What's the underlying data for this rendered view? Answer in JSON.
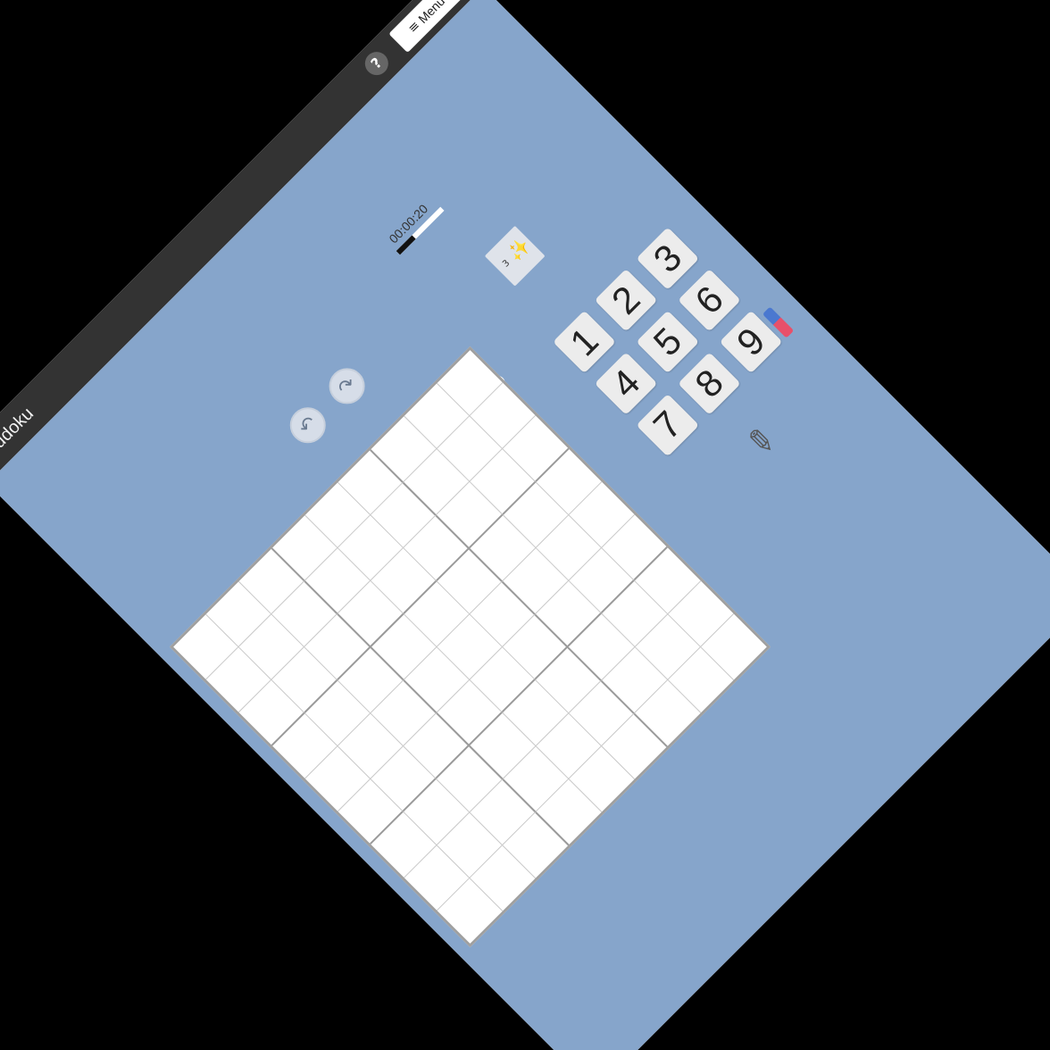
{
  "header": {
    "title": "Sudoku",
    "help_label": "?",
    "menu_label": "Menu",
    "menu_icon": "≡"
  },
  "toolbar": {
    "undo_icon": "undo-icon",
    "redo_icon": "redo-icon",
    "timer": "00:00:20",
    "timer_progress": 0.35,
    "hint_number": "3",
    "notes_numbers": [
      "1",
      "2",
      "3"
    ]
  },
  "keypad": {
    "keys": [
      "1",
      "2",
      "3",
      "4",
      "5",
      "6",
      "7",
      "8",
      "9"
    ]
  },
  "board": {
    "rows": [
      [
        "",
        "",
        "",
        "",
        "",
        "",
        "",
        "",
        ""
      ],
      [
        "",
        "",
        "",
        "",
        "",
        "",
        "",
        "",
        ""
      ],
      [
        "",
        "",
        "",
        "",
        "",
        "",
        "",
        "",
        ""
      ],
      [
        "",
        "",
        "",
        "",
        "",
        "",
        "",
        "",
        ""
      ],
      [
        "",
        "",
        "",
        "",
        "",
        "",
        "",
        "",
        ""
      ],
      [
        "",
        "",
        "",
        "",
        "",
        "",
        "",
        "",
        ""
      ],
      [
        "",
        "",
        "",
        "",
        "",
        "",
        "",
        "",
        ""
      ],
      [
        "",
        "",
        "",
        "",
        "",
        "",
        "",
        "",
        ""
      ],
      [
        "",
        "",
        "",
        "",
        "",
        "",
        "",
        "",
        ""
      ]
    ]
  },
  "colors": {
    "background": "#86a5cb",
    "topbar": "#333333",
    "given_cell": "#e9e9e9"
  }
}
